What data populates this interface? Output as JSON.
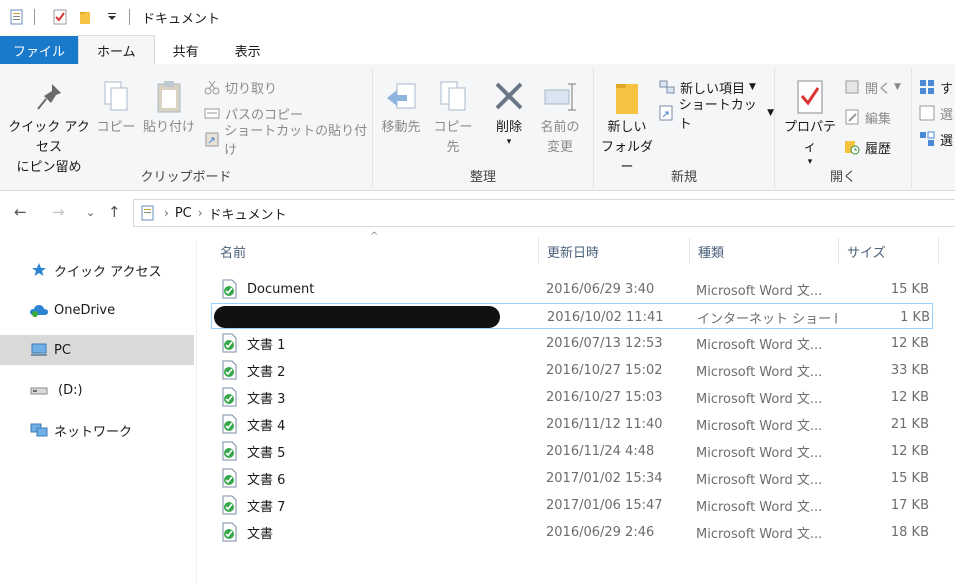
{
  "window": {
    "title": "ドキュメント"
  },
  "tabs": [
    "ファイル",
    "ホーム",
    "共有",
    "表示"
  ],
  "ribbon": {
    "clipboard": {
      "label": "クリップボード",
      "pin": [
        "クイック アクセス",
        "にピン留め"
      ],
      "copy": "コピー",
      "paste": "貼り付け",
      "cut": "切り取り",
      "copy_path": "パスのコピー",
      "paste_shortcut": "ショートカットの貼り付け"
    },
    "organize": {
      "label": "整理",
      "move_to": "移動先",
      "copy_to": "コピー先",
      "delete": "削除",
      "rename": [
        "名前の",
        "変更"
      ]
    },
    "new": {
      "label": "新規",
      "new_folder": [
        "新しい",
        "フォルダー"
      ],
      "new_item": "新しい項目",
      "shortcut": "ショートカット"
    },
    "open": {
      "label": "開く",
      "properties": "プロパティ",
      "open": "開く",
      "edit": "編集",
      "history": "履歴"
    },
    "select": {
      "a": "す",
      "b": "選",
      "c": "選"
    }
  },
  "address": {
    "crumbs": [
      "PC",
      "ドキュメント"
    ]
  },
  "nav": [
    {
      "label": "クイック アクセス",
      "icon": "star-icon"
    },
    {
      "label": "OneDrive",
      "icon": "cloud-icon"
    },
    {
      "label": "PC",
      "icon": "computer-icon"
    },
    {
      "label": "(D:)",
      "icon": "drive-icon"
    },
    {
      "label": "ネットワーク",
      "icon": "network-icon"
    }
  ],
  "columns": {
    "name": "名前",
    "date": "更新日時",
    "type": "種類",
    "size": "サイズ"
  },
  "files": [
    {
      "name": "Document",
      "date": "2016/06/29 3:40",
      "type": "Microsoft Word 文...",
      "size": "15 KB"
    },
    {
      "name": "",
      "date": "2016/10/02 11:41",
      "type": "インターネット ショート...",
      "size": "1 KB"
    },
    {
      "name": "文書 1",
      "date": "2016/07/13 12:53",
      "type": "Microsoft Word 文...",
      "size": "12 KB"
    },
    {
      "name": "文書 2",
      "date": "2016/10/27 15:02",
      "type": "Microsoft Word 文...",
      "size": "33 KB"
    },
    {
      "name": "文書 3",
      "date": "2016/10/27 15:03",
      "type": "Microsoft Word 文...",
      "size": "12 KB"
    },
    {
      "name": "文書 4",
      "date": "2016/11/12 11:40",
      "type": "Microsoft Word 文...",
      "size": "21 KB"
    },
    {
      "name": "文書 5",
      "date": "2016/11/24 4:48",
      "type": "Microsoft Word 文...",
      "size": "12 KB"
    },
    {
      "name": "文書 6",
      "date": "2017/01/02 15:34",
      "type": "Microsoft Word 文...",
      "size": "15 KB"
    },
    {
      "name": "文書 7",
      "date": "2017/01/06 15:47",
      "type": "Microsoft Word 文...",
      "size": "17 KB"
    },
    {
      "name": "文書",
      "date": "2016/06/29 2:46",
      "type": "Microsoft Word 文...",
      "size": "18 KB"
    }
  ],
  "colors": {
    "file_tab": "#1979ca",
    "selection": "#d9d9d9",
    "focus_border": "#99d1ff"
  }
}
